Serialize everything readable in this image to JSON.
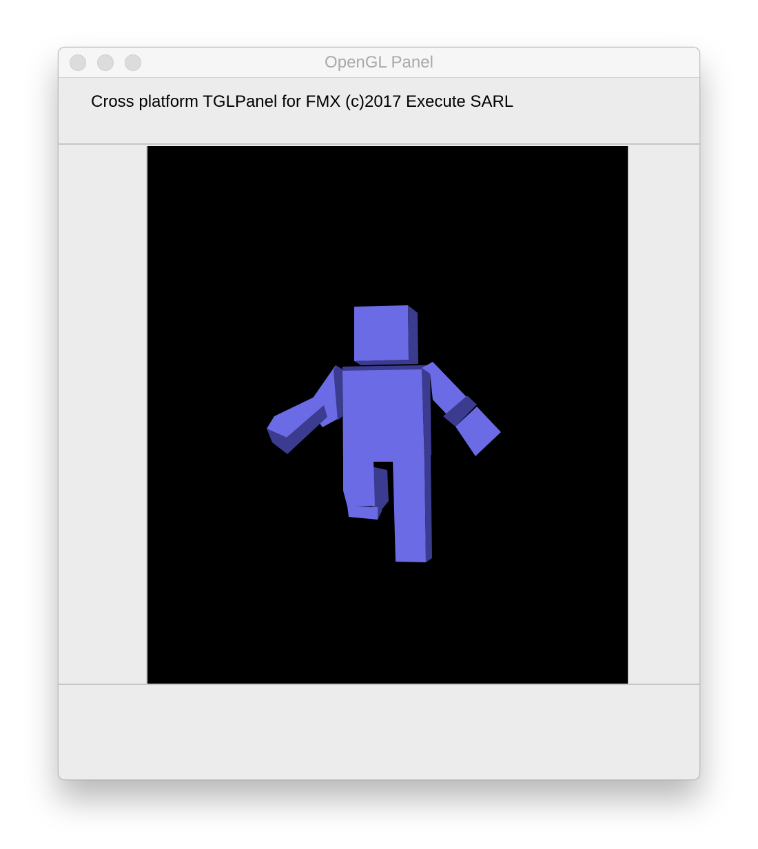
{
  "window": {
    "title": "OpenGL Panel"
  },
  "header": {
    "label": "Cross platform TGLPanel for FMX (c)2017 Execute SARL"
  },
  "gl_panel": {
    "background": "#000000",
    "model_colors": {
      "light": "#6b6be6",
      "dark": "#3b3b8f"
    }
  },
  "icons": {
    "close": "close-icon",
    "minimize": "minimize-icon",
    "zoom": "zoom-icon"
  }
}
